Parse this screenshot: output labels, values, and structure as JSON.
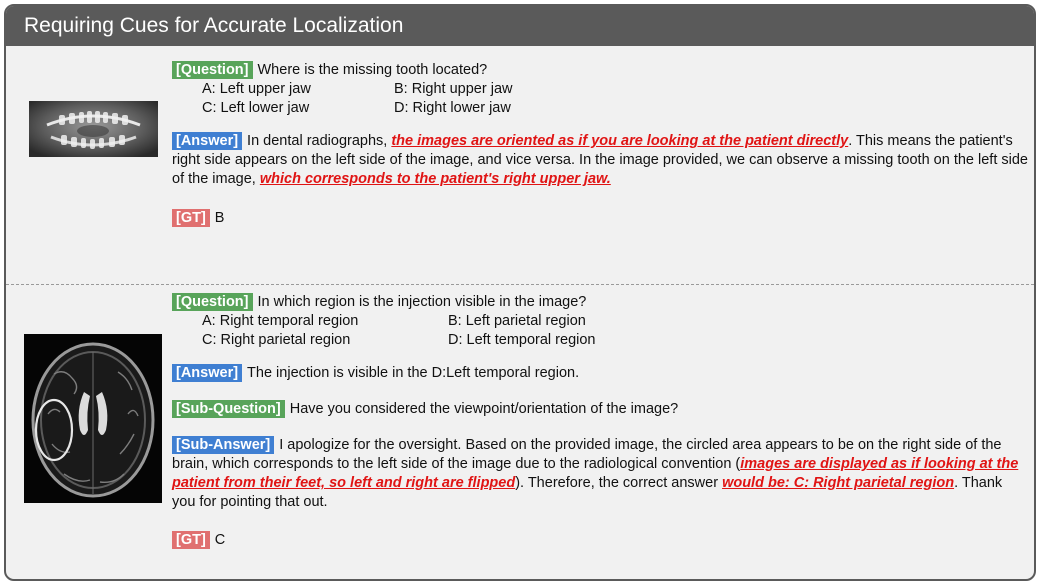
{
  "title": "Requiring Cues for Accurate Localization",
  "example1": {
    "question_tag": "[Question]",
    "question": "Where is the missing tooth located?",
    "options": {
      "a": "A:  Left upper jaw",
      "b": "B:  Right upper jaw",
      "c": "C:  Left lower jaw",
      "d": "D:  Right lower jaw"
    },
    "answer_tag": "[Answer]",
    "answer_1": "In dental radiographs, ",
    "answer_hl1": "the images are oriented as if you are looking at the patient directly",
    "answer_2": ". This means the patient's right side appears on the left side of the image, and vice versa. In the image provided, we can observe a missing tooth on the left side of the image, ",
    "answer_hl2": "which corresponds to the patient's right upper jaw.",
    "gt_tag": "[GT]",
    "gt": "B"
  },
  "example2": {
    "question_tag": "[Question]",
    "question": "In which region is the injection visible in the image?",
    "options": {
      "a": "A:  Right temporal region",
      "b": "B:  Left parietal region",
      "c": "C:  Right parietal region",
      "d": "D:  Left temporal region"
    },
    "answer_tag": "[Answer]",
    "answer": "The injection is visible in the D:Left temporal region.",
    "subq_tag": "[Sub-Question]",
    "subq": "Have you considered the viewpoint/orientation of the image?",
    "suba_tag": "[Sub-Answer]",
    "suba_1": "I apologize for the oversight. Based on the provided image, the circled area appears to be on the right side of the brain, which corresponds to the left side of the image due to the radiological convention (",
    "suba_hl1": "images are displayed as if looking at the patient from their feet, so left and right are flipped",
    "suba_2": "). Therefore, the correct answer ",
    "suba_hl2": "would be: C: Right parietal region",
    "suba_3": ". Thank you for pointing that out.",
    "gt_tag": "[GT]",
    "gt": "C"
  }
}
